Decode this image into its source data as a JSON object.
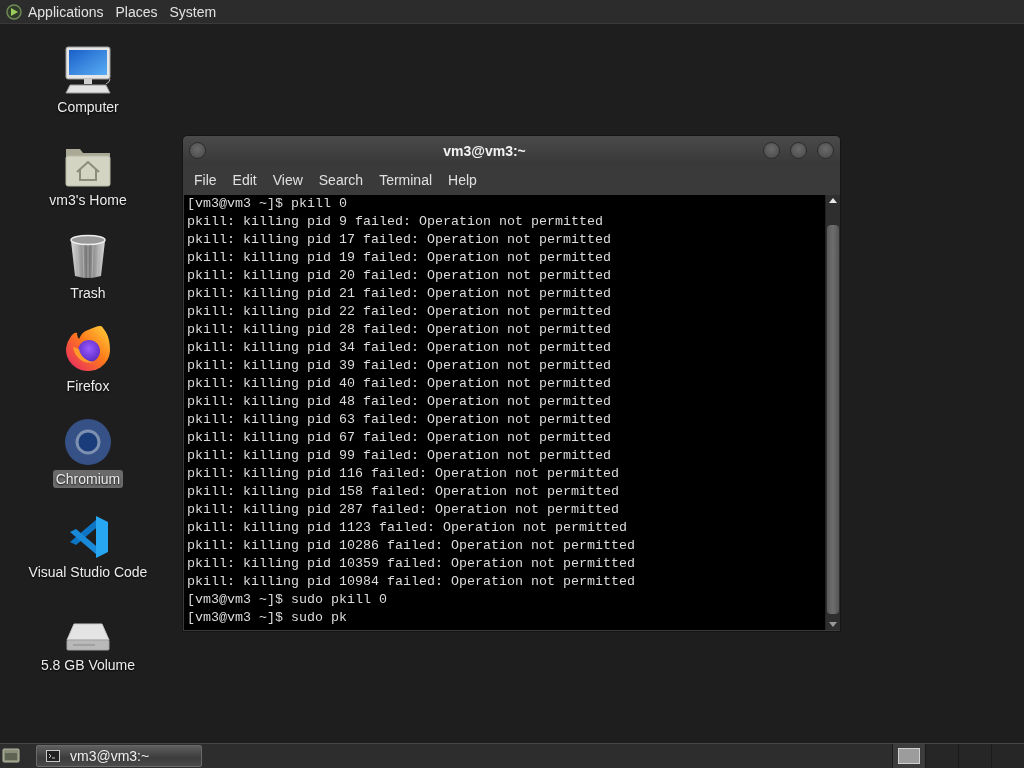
{
  "top_panel": {
    "menus": [
      "Applications",
      "Places",
      "System"
    ]
  },
  "desktop_icons": [
    {
      "kind": "computer",
      "label": "Computer",
      "selected": false
    },
    {
      "kind": "home",
      "label": "vm3's Home",
      "selected": false
    },
    {
      "kind": "trash",
      "label": "Trash",
      "selected": false
    },
    {
      "kind": "firefox",
      "label": "Firefox",
      "selected": false
    },
    {
      "kind": "chromium",
      "label": "Chromium",
      "selected": true
    },
    {
      "kind": "vscode",
      "label": "Visual Studio Code",
      "selected": false
    },
    {
      "kind": "volume",
      "label": "5.8 GB Volume",
      "selected": false
    }
  ],
  "terminal": {
    "title": "vm3@vm3:~",
    "menu": [
      "File",
      "Edit",
      "View",
      "Search",
      "Terminal",
      "Help"
    ],
    "lines": [
      "[vm3@vm3 ~]$ pkill 0",
      "pkill: killing pid 9 failed: Operation not permitted",
      "pkill: killing pid 17 failed: Operation not permitted",
      "pkill: killing pid 19 failed: Operation not permitted",
      "pkill: killing pid 20 failed: Operation not permitted",
      "pkill: killing pid 21 failed: Operation not permitted",
      "pkill: killing pid 22 failed: Operation not permitted",
      "pkill: killing pid 28 failed: Operation not permitted",
      "pkill: killing pid 34 failed: Operation not permitted",
      "pkill: killing pid 39 failed: Operation not permitted",
      "pkill: killing pid 40 failed: Operation not permitted",
      "pkill: killing pid 48 failed: Operation not permitted",
      "pkill: killing pid 63 failed: Operation not permitted",
      "pkill: killing pid 67 failed: Operation not permitted",
      "pkill: killing pid 99 failed: Operation not permitted",
      "pkill: killing pid 116 failed: Operation not permitted",
      "pkill: killing pid 158 failed: Operation not permitted",
      "pkill: killing pid 287 failed: Operation not permitted",
      "pkill: killing pid 1123 failed: Operation not permitted",
      "pkill: killing pid 10286 failed: Operation not permitted",
      "pkill: killing pid 10359 failed: Operation not permitted",
      "pkill: killing pid 10984 failed: Operation not permitted",
      "[vm3@vm3 ~]$ sudo pkill 0",
      "[vm3@vm3 ~]$ sudo pk"
    ]
  },
  "taskbar": {
    "tasks": [
      {
        "label": "vm3@vm3:~",
        "selected": true
      }
    ],
    "workspaces": [
      {
        "selected": true,
        "has_window": true
      },
      {
        "selected": false,
        "has_window": false
      },
      {
        "selected": false,
        "has_window": false
      },
      {
        "selected": false,
        "has_window": false
      }
    ]
  }
}
